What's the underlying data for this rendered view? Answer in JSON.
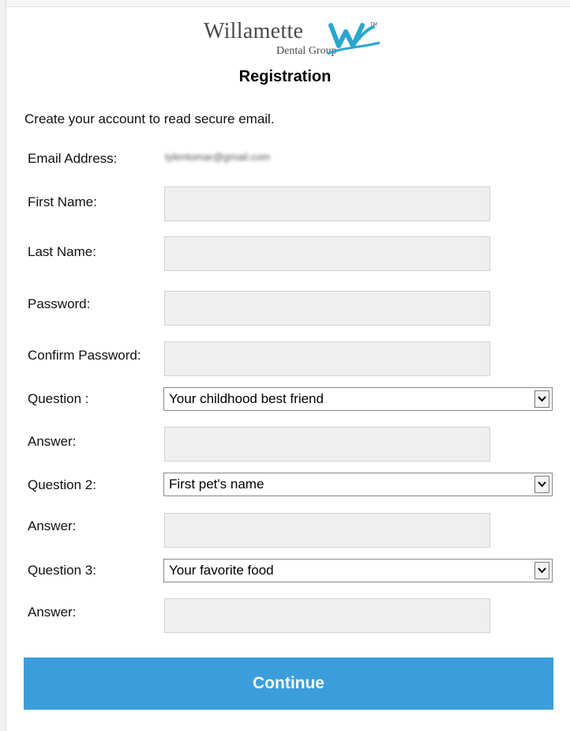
{
  "brand": {
    "name": "Willamette",
    "subtitle": "Dental Group",
    "trademark": "TM",
    "colors": {
      "text": "#4a4a4a",
      "accent": "#2aa6cf"
    }
  },
  "page": {
    "title": "Registration",
    "intro": "Create your account to read secure email."
  },
  "form": {
    "email_label": "Email Address:",
    "email_value": "tylentomar@gmail.com",
    "first_name_label": "First Name:",
    "last_name_label": "Last Name:",
    "password_label": "Password:",
    "confirm_password_label": "Confirm Password:",
    "question1_label": "Question :",
    "question1_value": "Your childhood best friend",
    "answer1_label": "Answer:",
    "question2_label": "Question 2:",
    "question2_value": "First pet's name",
    "answer2_label": "Answer:",
    "question3_label": "Question 3:",
    "question3_value": "Your favorite food",
    "answer3_label": "Answer:"
  },
  "actions": {
    "continue_label": "Continue",
    "continue_color": "#3b9edb"
  }
}
